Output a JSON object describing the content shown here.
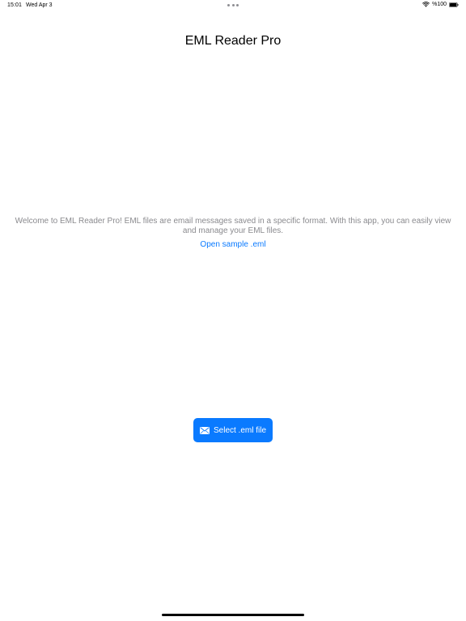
{
  "status_bar": {
    "time": "15:01",
    "date": "Wed Apr 3",
    "battery_label": "%100",
    "icons": [
      "wifi-icon",
      "battery-icon"
    ]
  },
  "app": {
    "title": "EML Reader Pro"
  },
  "welcome": {
    "message": "Welcome to EML Reader Pro! EML files are email messages saved in a specific format. With this app, you can easily view and manage your EML files.",
    "sample_link": "Open sample .eml"
  },
  "actions": {
    "select_button_label": "Select .eml file",
    "select_button_icon": "envelope-icon"
  },
  "colors": {
    "accent": "#0a7aff",
    "secondary_text": "#8a8a8e",
    "background": "#ffffff"
  }
}
